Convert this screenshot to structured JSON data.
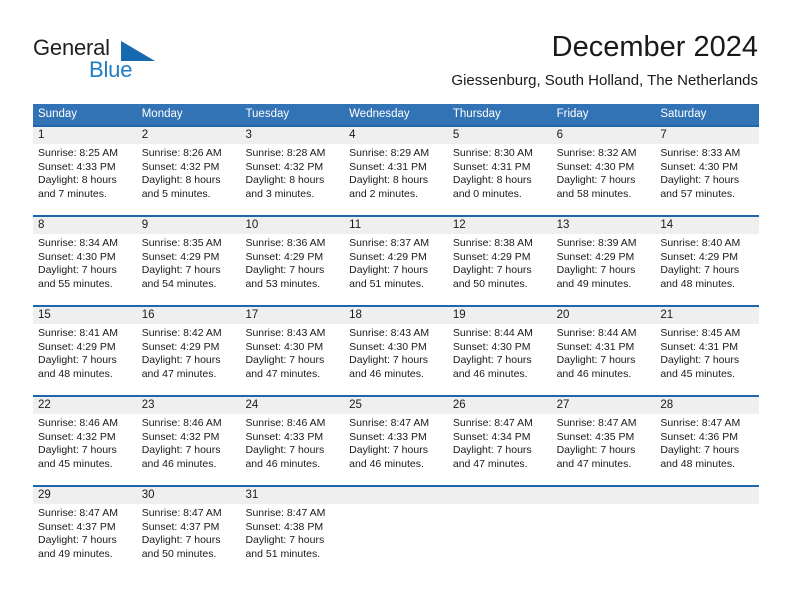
{
  "brand": {
    "name_part1": "General",
    "name_part2": "Blue",
    "logo_icon": "blue-triangle-icon",
    "accent_color": "#1769b0"
  },
  "header": {
    "title": "December 2024",
    "subtitle": "Giessenburg, South Holland, The Netherlands"
  },
  "theme": {
    "header_bg": "#3273b5",
    "header_text": "#ffffff",
    "week_divider": "#1f66ad",
    "daynum_bg": "#efefef",
    "cell_bg": "#ffffff",
    "text": "#1a1a1a"
  },
  "weekdays": [
    "Sunday",
    "Monday",
    "Tuesday",
    "Wednesday",
    "Thursday",
    "Friday",
    "Saturday"
  ],
  "weeks": [
    {
      "days": [
        {
          "num": "1",
          "sunrise": "Sunrise: 8:25 AM",
          "sunset": "Sunset: 4:33 PM",
          "daylight1": "Daylight: 8 hours",
          "daylight2": "and 7 minutes."
        },
        {
          "num": "2",
          "sunrise": "Sunrise: 8:26 AM",
          "sunset": "Sunset: 4:32 PM",
          "daylight1": "Daylight: 8 hours",
          "daylight2": "and 5 minutes."
        },
        {
          "num": "3",
          "sunrise": "Sunrise: 8:28 AM",
          "sunset": "Sunset: 4:32 PM",
          "daylight1": "Daylight: 8 hours",
          "daylight2": "and 3 minutes."
        },
        {
          "num": "4",
          "sunrise": "Sunrise: 8:29 AM",
          "sunset": "Sunset: 4:31 PM",
          "daylight1": "Daylight: 8 hours",
          "daylight2": "and 2 minutes."
        },
        {
          "num": "5",
          "sunrise": "Sunrise: 8:30 AM",
          "sunset": "Sunset: 4:31 PM",
          "daylight1": "Daylight: 8 hours",
          "daylight2": "and 0 minutes."
        },
        {
          "num": "6",
          "sunrise": "Sunrise: 8:32 AM",
          "sunset": "Sunset: 4:30 PM",
          "daylight1": "Daylight: 7 hours",
          "daylight2": "and 58 minutes."
        },
        {
          "num": "7",
          "sunrise": "Sunrise: 8:33 AM",
          "sunset": "Sunset: 4:30 PM",
          "daylight1": "Daylight: 7 hours",
          "daylight2": "and 57 minutes."
        }
      ]
    },
    {
      "days": [
        {
          "num": "8",
          "sunrise": "Sunrise: 8:34 AM",
          "sunset": "Sunset: 4:30 PM",
          "daylight1": "Daylight: 7 hours",
          "daylight2": "and 55 minutes."
        },
        {
          "num": "9",
          "sunrise": "Sunrise: 8:35 AM",
          "sunset": "Sunset: 4:29 PM",
          "daylight1": "Daylight: 7 hours",
          "daylight2": "and 54 minutes."
        },
        {
          "num": "10",
          "sunrise": "Sunrise: 8:36 AM",
          "sunset": "Sunset: 4:29 PM",
          "daylight1": "Daylight: 7 hours",
          "daylight2": "and 53 minutes."
        },
        {
          "num": "11",
          "sunrise": "Sunrise: 8:37 AM",
          "sunset": "Sunset: 4:29 PM",
          "daylight1": "Daylight: 7 hours",
          "daylight2": "and 51 minutes."
        },
        {
          "num": "12",
          "sunrise": "Sunrise: 8:38 AM",
          "sunset": "Sunset: 4:29 PM",
          "daylight1": "Daylight: 7 hours",
          "daylight2": "and 50 minutes."
        },
        {
          "num": "13",
          "sunrise": "Sunrise: 8:39 AM",
          "sunset": "Sunset: 4:29 PM",
          "daylight1": "Daylight: 7 hours",
          "daylight2": "and 49 minutes."
        },
        {
          "num": "14",
          "sunrise": "Sunrise: 8:40 AM",
          "sunset": "Sunset: 4:29 PM",
          "daylight1": "Daylight: 7 hours",
          "daylight2": "and 48 minutes."
        }
      ]
    },
    {
      "days": [
        {
          "num": "15",
          "sunrise": "Sunrise: 8:41 AM",
          "sunset": "Sunset: 4:29 PM",
          "daylight1": "Daylight: 7 hours",
          "daylight2": "and 48 minutes."
        },
        {
          "num": "16",
          "sunrise": "Sunrise: 8:42 AM",
          "sunset": "Sunset: 4:29 PM",
          "daylight1": "Daylight: 7 hours",
          "daylight2": "and 47 minutes."
        },
        {
          "num": "17",
          "sunrise": "Sunrise: 8:43 AM",
          "sunset": "Sunset: 4:30 PM",
          "daylight1": "Daylight: 7 hours",
          "daylight2": "and 47 minutes."
        },
        {
          "num": "18",
          "sunrise": "Sunrise: 8:43 AM",
          "sunset": "Sunset: 4:30 PM",
          "daylight1": "Daylight: 7 hours",
          "daylight2": "and 46 minutes."
        },
        {
          "num": "19",
          "sunrise": "Sunrise: 8:44 AM",
          "sunset": "Sunset: 4:30 PM",
          "daylight1": "Daylight: 7 hours",
          "daylight2": "and 46 minutes."
        },
        {
          "num": "20",
          "sunrise": "Sunrise: 8:44 AM",
          "sunset": "Sunset: 4:31 PM",
          "daylight1": "Daylight: 7 hours",
          "daylight2": "and 46 minutes."
        },
        {
          "num": "21",
          "sunrise": "Sunrise: 8:45 AM",
          "sunset": "Sunset: 4:31 PM",
          "daylight1": "Daylight: 7 hours",
          "daylight2": "and 45 minutes."
        }
      ]
    },
    {
      "days": [
        {
          "num": "22",
          "sunrise": "Sunrise: 8:46 AM",
          "sunset": "Sunset: 4:32 PM",
          "daylight1": "Daylight: 7 hours",
          "daylight2": "and 45 minutes."
        },
        {
          "num": "23",
          "sunrise": "Sunrise: 8:46 AM",
          "sunset": "Sunset: 4:32 PM",
          "daylight1": "Daylight: 7 hours",
          "daylight2": "and 46 minutes."
        },
        {
          "num": "24",
          "sunrise": "Sunrise: 8:46 AM",
          "sunset": "Sunset: 4:33 PM",
          "daylight1": "Daylight: 7 hours",
          "daylight2": "and 46 minutes."
        },
        {
          "num": "25",
          "sunrise": "Sunrise: 8:47 AM",
          "sunset": "Sunset: 4:33 PM",
          "daylight1": "Daylight: 7 hours",
          "daylight2": "and 46 minutes."
        },
        {
          "num": "26",
          "sunrise": "Sunrise: 8:47 AM",
          "sunset": "Sunset: 4:34 PM",
          "daylight1": "Daylight: 7 hours",
          "daylight2": "and 47 minutes."
        },
        {
          "num": "27",
          "sunrise": "Sunrise: 8:47 AM",
          "sunset": "Sunset: 4:35 PM",
          "daylight1": "Daylight: 7 hours",
          "daylight2": "and 47 minutes."
        },
        {
          "num": "28",
          "sunrise": "Sunrise: 8:47 AM",
          "sunset": "Sunset: 4:36 PM",
          "daylight1": "Daylight: 7 hours",
          "daylight2": "and 48 minutes."
        }
      ]
    },
    {
      "days": [
        {
          "num": "29",
          "sunrise": "Sunrise: 8:47 AM",
          "sunset": "Sunset: 4:37 PM",
          "daylight1": "Daylight: 7 hours",
          "daylight2": "and 49 minutes."
        },
        {
          "num": "30",
          "sunrise": "Sunrise: 8:47 AM",
          "sunset": "Sunset: 4:37 PM",
          "daylight1": "Daylight: 7 hours",
          "daylight2": "and 50 minutes."
        },
        {
          "num": "31",
          "sunrise": "Sunrise: 8:47 AM",
          "sunset": "Sunset: 4:38 PM",
          "daylight1": "Daylight: 7 hours",
          "daylight2": "and 51 minutes."
        },
        {
          "num": "",
          "sunrise": "",
          "sunset": "",
          "daylight1": "",
          "daylight2": ""
        },
        {
          "num": "",
          "sunrise": "",
          "sunset": "",
          "daylight1": "",
          "daylight2": ""
        },
        {
          "num": "",
          "sunrise": "",
          "sunset": "",
          "daylight1": "",
          "daylight2": ""
        },
        {
          "num": "",
          "sunrise": "",
          "sunset": "",
          "daylight1": "",
          "daylight2": ""
        }
      ]
    }
  ]
}
